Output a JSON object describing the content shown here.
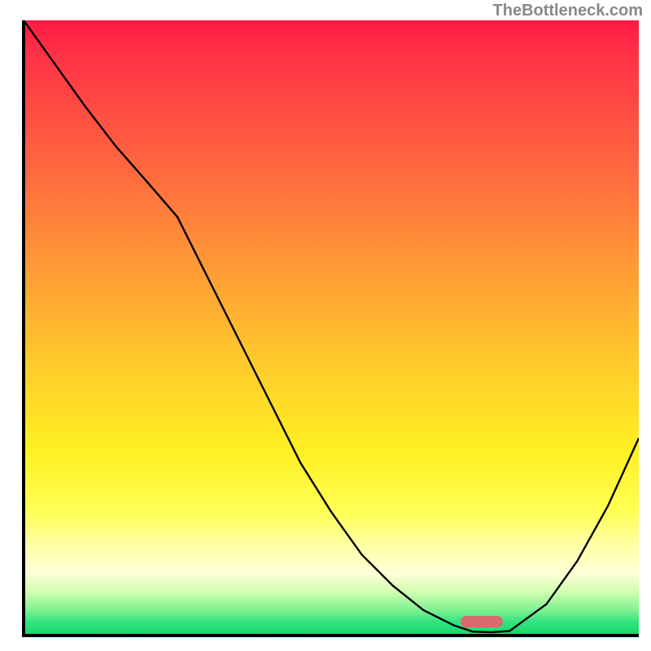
{
  "attribution": "TheBottleneck.com",
  "chart_data": {
    "type": "line",
    "title": "",
    "xlabel": "",
    "ylabel": "",
    "x": [
      0,
      5,
      10,
      15,
      20,
      25,
      30,
      35,
      40,
      45,
      50,
      55,
      60,
      65,
      70,
      73,
      76,
      79,
      85,
      90,
      95,
      100
    ],
    "values": [
      100,
      93,
      86,
      79.5,
      73.8,
      68,
      58,
      48,
      38,
      28,
      20,
      13,
      8,
      4,
      1.5,
      0.5,
      0.4,
      0.6,
      5,
      12,
      21,
      32
    ],
    "xlim": [
      0,
      100
    ],
    "ylim": [
      0,
      100
    ],
    "marker_x": 74.5,
    "marker_y": 0.5,
    "background": "gradient-red-to-green"
  }
}
